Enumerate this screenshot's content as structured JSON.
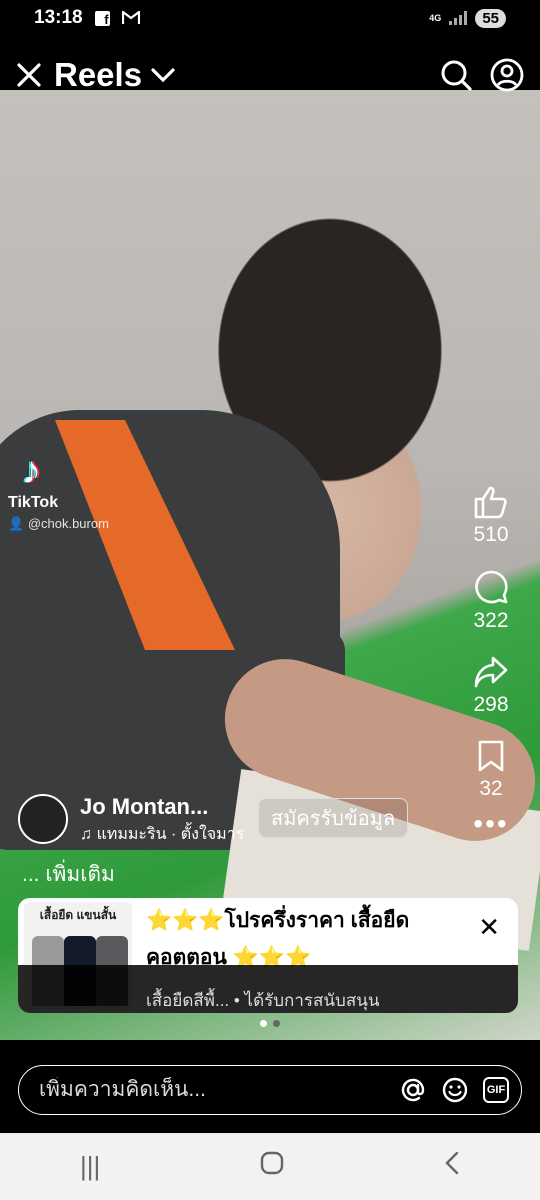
{
  "status": {
    "time": "13:18",
    "network": "4G",
    "battery": "55",
    "app_icons": [
      "facebook-icon",
      "gmail-icon"
    ]
  },
  "header": {
    "title": "Reels"
  },
  "watermark": {
    "logo": "TikTok",
    "username": "@chok.burom"
  },
  "actions": {
    "likes": "510",
    "comments": "322",
    "shares": "298",
    "saves": "32"
  },
  "author": {
    "name": "Jo Montan...",
    "music": "แทมมะริน · ตั้งใจมาร",
    "signup_label": "สมัครรับข้อมูล",
    "see_more": "... เพิ่มเติม"
  },
  "ad": {
    "thumb_header": "เสื้อยืด แขนสั้น",
    "line1": "⭐⭐⭐โปรครึ่งราคา เสื้อยืด",
    "line2": "คอตตอน ⭐⭐⭐",
    "footer": "เสื้อยืดสีพื้... • ได้รับการสนับสนุน"
  },
  "comment": {
    "placeholder": "เพิ่มความคิดเห็น..."
  },
  "colors": {
    "accent_orange": "#e56a2a",
    "tiktok_cyan": "#25f4ee",
    "tiktok_pink": "#fe2c55"
  }
}
